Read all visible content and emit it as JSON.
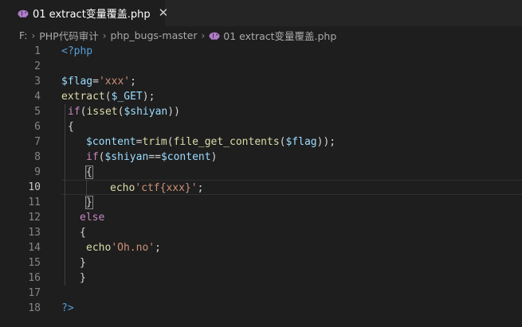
{
  "tab": {
    "label": "01 extract变量覆盖.php",
    "icon": "php-elephant-icon",
    "close_glyph": "✕"
  },
  "breadcrumb": {
    "drive": "F:",
    "folder1": "PHP代码审计",
    "folder2": "php_bugs-master",
    "file": "01 extract变量覆盖.php"
  },
  "colors": {
    "keyword": "#569cd6",
    "control": "#c586c0",
    "variable": "#9cdcfe",
    "string": "#ce9178",
    "function": "#dcdcaa",
    "php_icon": "#b07cc9"
  },
  "editor": {
    "active_line": 10,
    "lines": [
      {
        "n": "1",
        "tokens": [
          [
            "kw",
            "<?php"
          ]
        ]
      },
      {
        "n": "2",
        "tokens": []
      },
      {
        "n": "3",
        "tokens": [
          [
            "var",
            "$flag"
          ],
          [
            "pl",
            "="
          ],
          [
            "str",
            "'xxx'"
          ],
          [
            "pl",
            ";"
          ]
        ]
      },
      {
        "n": "4",
        "tokens": [
          [
            "fn",
            "extract"
          ],
          [
            "pl",
            "("
          ],
          [
            "var",
            "$_GET"
          ],
          [
            "pl",
            ");"
          ]
        ]
      },
      {
        "n": "5",
        "tokens": [
          [
            "ctl",
            "if"
          ],
          [
            "pl",
            "("
          ],
          [
            "fn",
            "isset"
          ],
          [
            "pl",
            "("
          ],
          [
            "var",
            "$shiyan"
          ],
          [
            "pl",
            "))"
          ]
        ]
      },
      {
        "n": "6",
        "tokens": [
          [
            "pl",
            "{"
          ]
        ]
      },
      {
        "n": "7",
        "tokens": [
          [
            "var",
            "$content"
          ],
          [
            "pl",
            "="
          ],
          [
            "fn",
            "trim"
          ],
          [
            "pl",
            "("
          ],
          [
            "fn",
            "file_get_contents"
          ],
          [
            "pl",
            "("
          ],
          [
            "var",
            "$flag"
          ],
          [
            "pl",
            "));"
          ]
        ]
      },
      {
        "n": "8",
        "tokens": [
          [
            "ctl",
            "if"
          ],
          [
            "pl",
            "("
          ],
          [
            "var",
            "$shiyan"
          ],
          [
            "pl",
            "=="
          ],
          [
            "var",
            "$content"
          ],
          [
            "pl",
            ")"
          ]
        ]
      },
      {
        "n": "9",
        "tokens": [
          [
            "pl",
            "{"
          ]
        ]
      },
      {
        "n": "10",
        "tokens": [
          [
            "fn",
            "echo"
          ],
          [
            "str",
            "'ctf{xxx}'"
          ],
          [
            "pl",
            ";"
          ]
        ]
      },
      {
        "n": "11",
        "tokens": [
          [
            "pl",
            "}"
          ]
        ]
      },
      {
        "n": "12",
        "tokens": [
          [
            "ctl",
            "else"
          ]
        ]
      },
      {
        "n": "13",
        "tokens": [
          [
            "pl",
            "{"
          ]
        ]
      },
      {
        "n": "14",
        "tokens": [
          [
            "fn",
            "echo"
          ],
          [
            "str",
            "'Oh.no'"
          ],
          [
            "pl",
            ";"
          ]
        ]
      },
      {
        "n": "15",
        "tokens": [
          [
            "pl",
            "}"
          ]
        ]
      },
      {
        "n": "16",
        "tokens": [
          [
            "pl",
            "}"
          ]
        ]
      },
      {
        "n": "17",
        "tokens": []
      },
      {
        "n": "18",
        "tokens": [
          [
            "kw",
            "?>"
          ]
        ]
      }
    ]
  }
}
